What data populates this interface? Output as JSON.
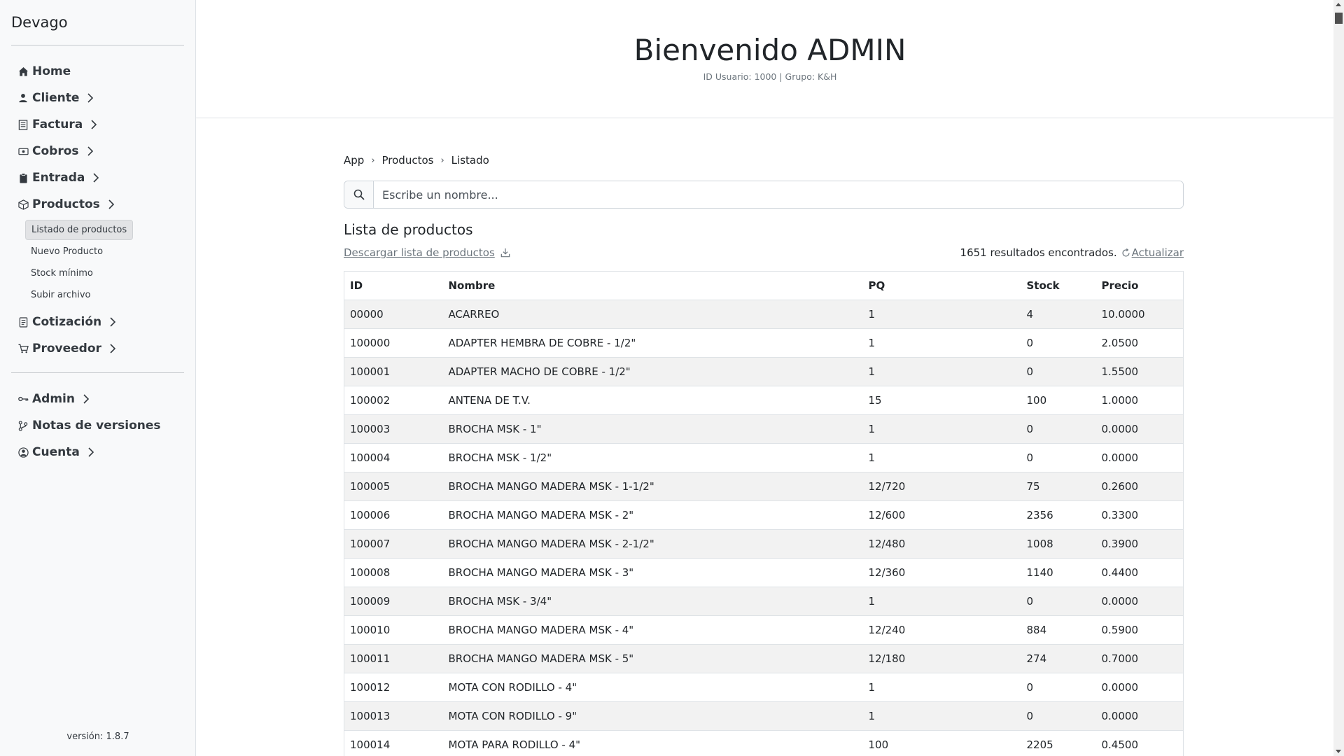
{
  "sidebar": {
    "brand": "Devago",
    "items": [
      {
        "label": "Home",
        "icon": "home-icon"
      },
      {
        "label": "Cliente",
        "icon": "user-icon"
      },
      {
        "label": "Factura",
        "icon": "invoice-icon"
      },
      {
        "label": "Cobros",
        "icon": "cash-icon"
      },
      {
        "label": "Entrada",
        "icon": "clipboard-icon"
      },
      {
        "label": "Productos",
        "icon": "box-icon"
      }
    ],
    "subitems": [
      {
        "label": "Listado de productos",
        "active": true
      },
      {
        "label": "Nuevo Producto"
      },
      {
        "label": "Stock mínimo"
      },
      {
        "label": "Subir archivo"
      }
    ],
    "items2": [
      {
        "label": "Cotización",
        "icon": "receipt-icon"
      },
      {
        "label": "Proveedor",
        "icon": "cart-icon"
      }
    ],
    "items3": [
      {
        "label": "Admin",
        "icon": "key-icon"
      },
      {
        "label": "Notas de versiones",
        "icon": "git-icon"
      },
      {
        "label": "Cuenta",
        "icon": "user-circle-icon"
      }
    ],
    "version": "versión: 1.8.7"
  },
  "header": {
    "title": "Bienvenido ADMIN",
    "subtitle": "ID Usuario: 1000 | Grupo: K&H"
  },
  "breadcrumb": [
    "App",
    "Productos",
    "Listado"
  ],
  "search": {
    "placeholder": "Escribe un nombre..."
  },
  "list": {
    "title": "Lista de productos",
    "download_label": "Descargar lista de productos",
    "results_text": "1651 resultados encontrados.",
    "refresh_label": "Actualizar"
  },
  "table": {
    "columns": [
      "ID",
      "Nombre",
      "PQ",
      "Stock",
      "Precio"
    ],
    "rows": [
      [
        "00000",
        "ACARREO",
        "1",
        "4",
        "10.0000"
      ],
      [
        "100000",
        "ADAPTER HEMBRA DE COBRE - 1/2\"",
        "1",
        "0",
        "2.0500"
      ],
      [
        "100001",
        "ADAPTER MACHO DE COBRE - 1/2\"",
        "1",
        "0",
        "1.5500"
      ],
      [
        "100002",
        "ANTENA DE T.V.",
        "15",
        "100",
        "1.0000"
      ],
      [
        "100003",
        "BROCHA MSK - 1\"",
        "1",
        "0",
        "0.0000"
      ],
      [
        "100004",
        "BROCHA MSK - 1/2\"",
        "1",
        "0",
        "0.0000"
      ],
      [
        "100005",
        "BROCHA MANGO MADERA MSK - 1-1/2\"",
        "12/720",
        "75",
        "0.2600"
      ],
      [
        "100006",
        "BROCHA MANGO MADERA MSK - 2\"",
        "12/600",
        "2356",
        "0.3300"
      ],
      [
        "100007",
        "BROCHA MANGO MADERA MSK - 2-1/2\"",
        "12/480",
        "1008",
        "0.3900"
      ],
      [
        "100008",
        "BROCHA MANGO MADERA MSK - 3\"",
        "12/360",
        "1140",
        "0.4400"
      ],
      [
        "100009",
        "BROCHA MSK - 3/4\"",
        "1",
        "0",
        "0.0000"
      ],
      [
        "100010",
        "BROCHA MANGO MADERA MSK - 4\"",
        "12/240",
        "884",
        "0.5900"
      ],
      [
        "100011",
        "BROCHA MANGO MADERA MSK - 5\"",
        "12/180",
        "274",
        "0.7000"
      ],
      [
        "100012",
        "MOTA CON RODILLO - 4\"",
        "1",
        "0",
        "0.0000"
      ],
      [
        "100013",
        "MOTA CON RODILLO - 9\"",
        "1",
        "0",
        "0.0000"
      ],
      [
        "100014",
        "MOTA PARA RODILLO - 4\"",
        "100",
        "2205",
        "0.4500"
      ]
    ]
  }
}
